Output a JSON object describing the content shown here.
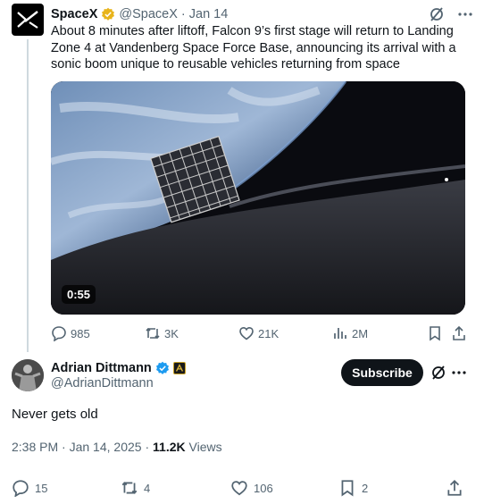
{
  "parent_tweet": {
    "author_name": "SpaceX",
    "handle": "@SpaceX",
    "separator": "·",
    "date": "Jan 14",
    "text": "About 8 minutes after liftoff, Falcon 9’s first stage will return to Landing Zone 4 at Vandenberg Space Force Base, announcing its arrival with a sonic boom unique to reusable vehicles returning from space",
    "video_duration": "0:55",
    "replies": "985",
    "reposts": "3K",
    "likes": "21K",
    "views": "2M"
  },
  "main_tweet": {
    "author_name": "Adrian Dittmann",
    "handle": "@AdrianDittmann",
    "subscribe_label": "Subscribe",
    "text": "Never gets old",
    "time": "2:38 PM",
    "separator": "·",
    "date": "Jan 14, 2025",
    "views_count": "11.2K",
    "views_label": "Views",
    "replies": "15",
    "reposts": "4",
    "likes": "106",
    "bookmarks": "2"
  },
  "colors": {
    "text": "#0f1419",
    "muted": "#536471",
    "verified_gold": "#e8b41b",
    "verified_blue": "#1d9bf0",
    "thread_line": "#cfd9de"
  },
  "icons": [
    "spacex-logo-icon",
    "gold-verified-icon",
    "grok-icon",
    "more-icon",
    "reply-icon",
    "repost-icon",
    "like-icon",
    "views-icon",
    "bookmark-icon",
    "share-icon",
    "blue-verified-icon",
    "affiliate-badge-icon"
  ]
}
